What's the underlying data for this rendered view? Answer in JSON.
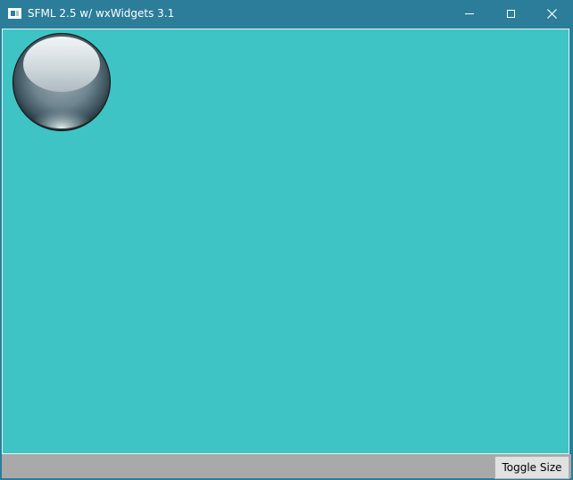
{
  "window": {
    "title": "SFML 2.5 w/ wxWidgets 3.1",
    "controls": {
      "minimize": "minimize-icon",
      "maximize": "maximize-icon",
      "close": "close-icon"
    }
  },
  "canvas": {
    "background_color": "#3ec4c4",
    "sprite": "glass-ball"
  },
  "bottom_bar": {
    "toggle_button_label": "Toggle Size"
  },
  "colors": {
    "titlebar": "#2b7d99",
    "canvas": "#3ec4c4",
    "bottom_bar": "#a9a9a9",
    "button_face": "#e1e1e1"
  }
}
